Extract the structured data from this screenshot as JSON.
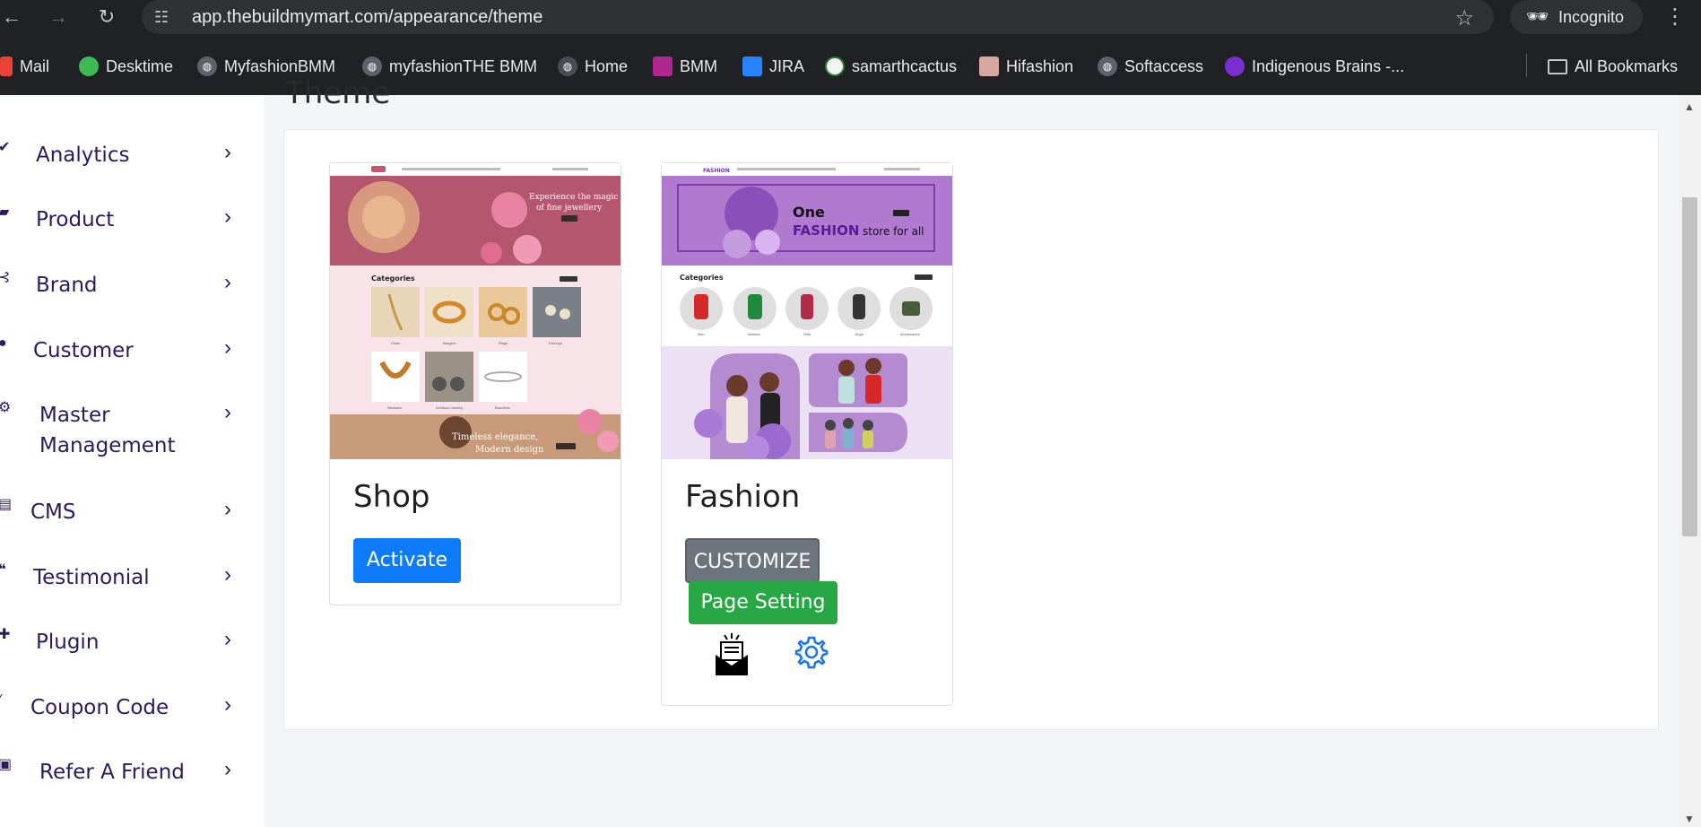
{
  "browser": {
    "url": "app.thebuildmymart.com/appearance/theme",
    "incognito_label": "Incognito",
    "bookmarks": [
      {
        "label": "Mail",
        "icon": "gmail-icon"
      },
      {
        "label": "Desktime",
        "icon": "desktime-icon"
      },
      {
        "label": "MyfashionBMM",
        "icon": "globe-icon"
      },
      {
        "label": "myfashionTHE BMM",
        "icon": "globe-icon"
      },
      {
        "label": "Home",
        "icon": "globe-icon"
      },
      {
        "label": "BMM",
        "icon": "bmm-icon"
      },
      {
        "label": "JIRA",
        "icon": "jira-icon"
      },
      {
        "label": "samarthcactus",
        "icon": "cactus-icon"
      },
      {
        "label": "Hifashion",
        "icon": "hifashion-icon"
      },
      {
        "label": "Softaccess",
        "icon": "globe-icon"
      },
      {
        "label": "Indigenous Brains -...",
        "icon": "indigenous-icon"
      }
    ],
    "all_bookmarks_label": "All Bookmarks"
  },
  "sidebar": {
    "items": [
      {
        "label": "Analytics",
        "icon": "analytics-icon"
      },
      {
        "label": "Product",
        "icon": "product-icon"
      },
      {
        "label": "Brand",
        "icon": "brand-icon"
      },
      {
        "label": "Customer",
        "icon": "customer-icon"
      },
      {
        "label": "Master",
        "label2": "Management",
        "icon": "master-management-icon"
      },
      {
        "label": "CMS",
        "icon": "cms-icon"
      },
      {
        "label": "Testimonial",
        "icon": "testimonial-icon"
      },
      {
        "label": "Plugin",
        "icon": "plugin-icon"
      },
      {
        "label": "Coupon Code",
        "icon": "coupon-icon"
      },
      {
        "label": "Refer A Friend",
        "icon": "refer-icon"
      }
    ]
  },
  "page": {
    "title": "Theme"
  },
  "themes": [
    {
      "name": "Shop",
      "activate_label": "Activate",
      "preview": {
        "hero_line1": "Experience the magic",
        "hero_line2": "of fine jewellery",
        "section": "Categories",
        "items": [
          "Chain",
          "Bangles",
          "Rings",
          "Earrings",
          "Necklace",
          "Oxidised Jewelry",
          "Bracelets"
        ],
        "banner_line1": "Timeless elegance,",
        "banner_line2": "Modern design"
      }
    },
    {
      "name": "Fashion",
      "customize_label": "CUSTOMIZE",
      "page_setting_label": "Page Setting",
      "preview": {
        "logo": "FASHION",
        "hero_line1": "One",
        "hero_line2": "FASHION",
        "hero_line3": "store for all",
        "section": "Categories",
        "items": [
          "Men",
          "Women",
          "Girls",
          "Boys",
          "Accessories"
        ]
      }
    }
  ],
  "colors": {
    "activate": "#0d7bfa",
    "customize": "#6c757d",
    "page_setting": "#28a745",
    "sidebar_text": "#2a1a5e",
    "settings_icon": "#1a73e8"
  }
}
